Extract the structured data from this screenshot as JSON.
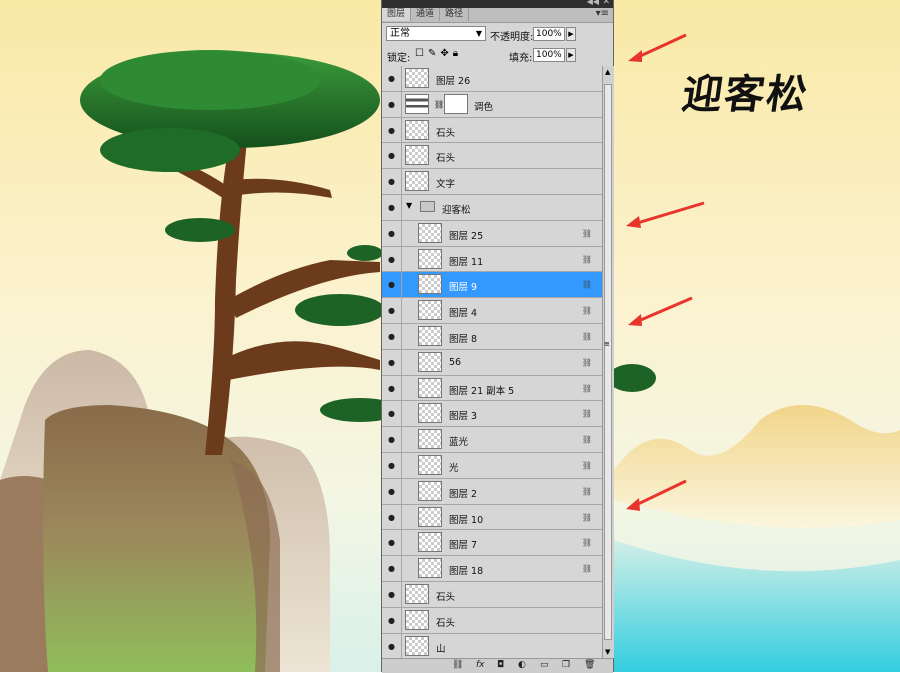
{
  "artwork_text": "迎客松",
  "panel": {
    "tabs": [
      "图层",
      "通道",
      "路径"
    ],
    "blend_mode": "正常",
    "opacity_label": "不透明度:",
    "opacity_value": "100%",
    "lock_label": "锁定:",
    "fill_label": "填充:",
    "fill_value": "100%"
  },
  "layers": [
    {
      "name": "图层 26",
      "indent": 0,
      "linked": false
    },
    {
      "name": "调色",
      "indent": 0,
      "type": "adjustment",
      "linked": false
    },
    {
      "name": "石头",
      "indent": 0,
      "linked": false
    },
    {
      "name": "石头",
      "indent": 0,
      "linked": false
    },
    {
      "name": "文字",
      "indent": 0,
      "linked": false
    },
    {
      "name": "迎客松",
      "indent": 0,
      "type": "group",
      "linked": false
    },
    {
      "name": "图层 25",
      "indent": 1,
      "linked": true
    },
    {
      "name": "图层 11",
      "indent": 1,
      "linked": true
    },
    {
      "name": "图层 9",
      "indent": 1,
      "linked": true,
      "selected": true
    },
    {
      "name": "图层 4",
      "indent": 1,
      "linked": true
    },
    {
      "name": "图层 8",
      "indent": 1,
      "linked": true
    },
    {
      "name": "56",
      "indent": 1,
      "linked": true
    },
    {
      "name": "图层 21 副本 5",
      "indent": 1,
      "linked": true
    },
    {
      "name": "图层 3",
      "indent": 1,
      "linked": true
    },
    {
      "name": "蓝光",
      "indent": 1,
      "linked": true
    },
    {
      "name": "光",
      "indent": 1,
      "linked": true
    },
    {
      "name": "图层 2",
      "indent": 1,
      "linked": true
    },
    {
      "name": "图层 10",
      "indent": 1,
      "linked": true
    },
    {
      "name": "图层 7",
      "indent": 1,
      "linked": true
    },
    {
      "name": "图层 18",
      "indent": 1,
      "linked": true
    },
    {
      "name": "石头",
      "indent": 0,
      "linked": false
    },
    {
      "name": "石头",
      "indent": 0,
      "linked": false
    },
    {
      "name": "山",
      "indent": 0,
      "linked": false
    }
  ],
  "colors": {
    "selection": "#3399ff",
    "arrow": "#e8342a",
    "panel_bg": "#d6d6d6"
  }
}
